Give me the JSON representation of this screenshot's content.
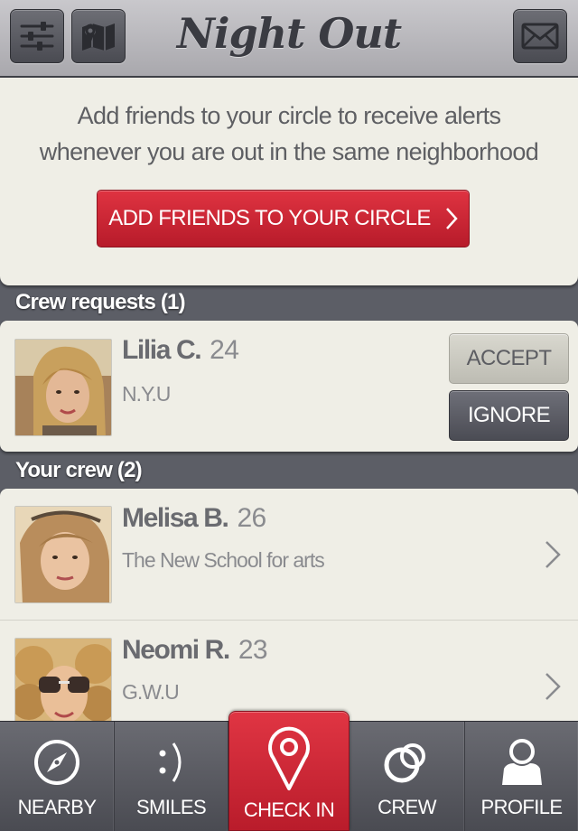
{
  "header": {
    "title": "Night Out",
    "left_icons": [
      "settings-sliders-icon",
      "map-icon"
    ],
    "right_icon": "envelope-icon"
  },
  "invite": {
    "message": "Add friends to your circle to receive alerts whenever you are out in the same neighborhood",
    "button_label": "ADD FRIENDS TO YOUR CIRCLE"
  },
  "crew_requests": {
    "title": "Crew requests (1)",
    "items": [
      {
        "name": "Lilia C.",
        "age": "24",
        "school": "N.Y.U",
        "accept_label": "ACCEPT",
        "ignore_label": "IGNORE"
      }
    ]
  },
  "your_crew": {
    "title": "Your crew (2)",
    "items": [
      {
        "name": "Melisa B.",
        "age": "26",
        "school": "The New School for arts"
      },
      {
        "name": "Neomi R.",
        "age": "23",
        "school": "G.W.U"
      }
    ]
  },
  "tabbar": {
    "tabs": [
      {
        "label": "NEARBY",
        "icon": "compass-icon"
      },
      {
        "label": "SMILES",
        "icon": "smiley-icon"
      },
      {
        "label": "CHECK IN",
        "icon": "location-pin-icon",
        "active": true
      },
      {
        "label": "CREW",
        "icon": "rings-icon"
      },
      {
        "label": "PROFILE",
        "icon": "person-icon"
      }
    ]
  },
  "colors": {
    "accent_red": "#c8222f",
    "panel": "#efeee6",
    "background": "#5c5e66",
    "header": "#b9b8bd"
  }
}
